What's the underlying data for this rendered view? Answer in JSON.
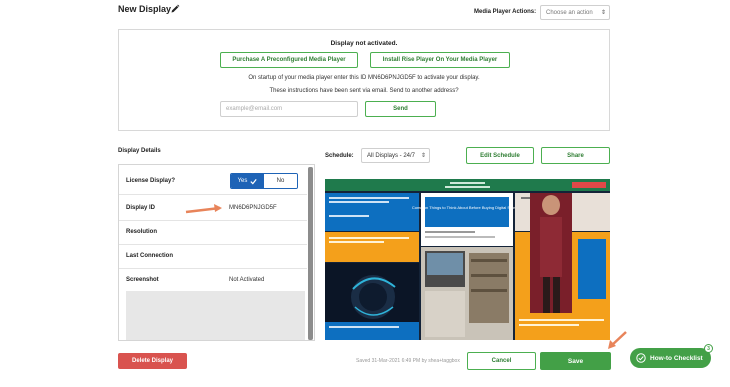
{
  "header": {
    "title": "New Display",
    "edit_icon": "pencil-icon",
    "actions_label": "Media Player Actions:",
    "actions_placeholder": "Choose an action"
  },
  "activation": {
    "title": "Display not activated.",
    "purchase_label": "Purchase A Preconfigured Media Player",
    "or_label": "or",
    "install_label": "Install Rise Player On Your Media Player",
    "startup_text": "On startup of your media player enter this ID MN6D6PNJGD5F to activate your display.",
    "instructions_text": "These instructions have been sent via email. Send to another address?",
    "email_placeholder": "example@email.com",
    "send_label": "Send"
  },
  "details": {
    "section_label": "Display Details",
    "license_label": "License Display?",
    "license_yes": "Yes",
    "license_no": "No",
    "license_selected": "Yes",
    "display_id_label": "Display ID",
    "display_id_value": "MN6D6PNJGD5F",
    "resolution_label": "Resolution",
    "last_connection_label": "Last Connection",
    "screenshot_label": "Screenshot",
    "screenshot_value": "Not Activated"
  },
  "schedule": {
    "label": "Schedule:",
    "selected": "All Displays - 24/7",
    "edit_label": "Edit Schedule",
    "share_label": "Share"
  },
  "preview": {
    "headline": "Common Things to Think About Before Buying Digital Signage"
  },
  "footer": {
    "delete_label": "Delete Display",
    "saved_text": "Saved 31-Mar-2021 6:49 PM by shea+taggbox",
    "cancel_label": "Cancel",
    "save_label": "Save",
    "checklist_label": "How-to Checklist",
    "checklist_badge": "3"
  },
  "colors": {
    "accent_green": "#43a047",
    "toggle_blue": "#1e63b6",
    "danger_red": "#d9534f",
    "annotation_arrow": "#e8845a"
  }
}
